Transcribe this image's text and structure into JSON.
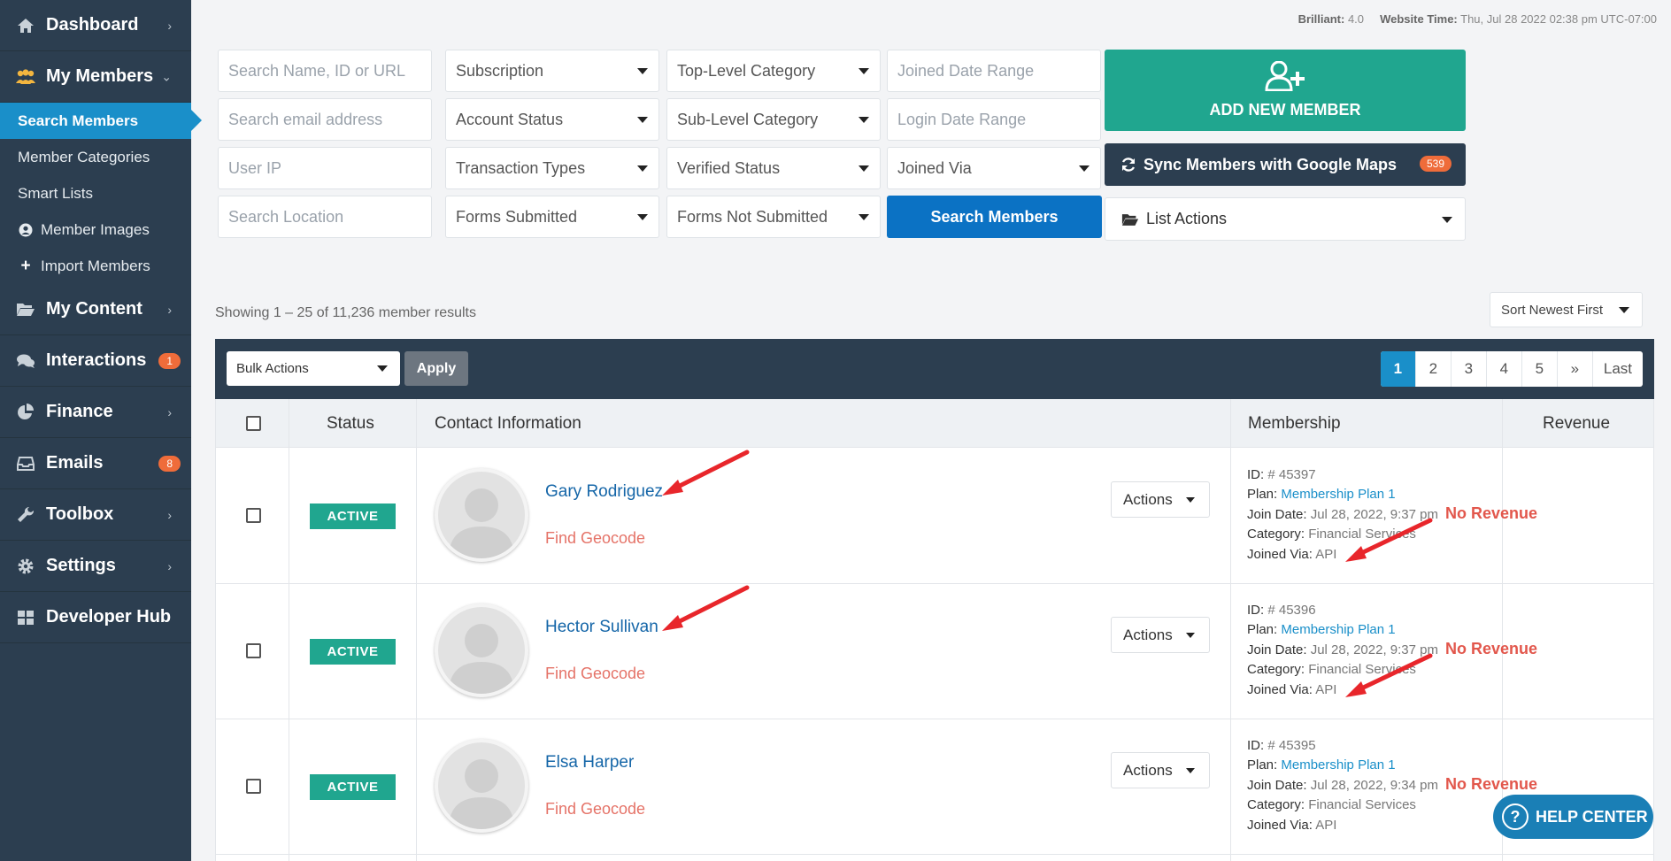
{
  "sidebar": {
    "items": [
      {
        "label": "Dashboard",
        "icon": "home-icon"
      },
      {
        "label": "My Members",
        "icon": "users-icon"
      },
      {
        "label": "My Content",
        "icon": "folder-icon"
      },
      {
        "label": "Interactions",
        "icon": "comments-icon",
        "badge": "1"
      },
      {
        "label": "Finance",
        "icon": "pie-chart-icon"
      },
      {
        "label": "Emails",
        "icon": "inbox-icon",
        "badge": "8"
      },
      {
        "label": "Toolbox",
        "icon": "wrench-icon"
      },
      {
        "label": "Settings",
        "icon": "gear-icon"
      },
      {
        "label": "Developer Hub",
        "icon": "grid-icon"
      }
    ],
    "submenu": [
      {
        "label": "Search Members"
      },
      {
        "label": "Member Categories"
      },
      {
        "label": "Smart Lists"
      },
      {
        "label": "Member Images",
        "icon": "user-circle-icon"
      },
      {
        "label": "Import Members",
        "icon": "plus-icon"
      }
    ]
  },
  "header": {
    "version_label": "Brilliant:",
    "version_value": "4.0",
    "time_label": "Website Time:",
    "time_value": "Thu, Jul 28 2022 02:38 pm UTC-07:00"
  },
  "filters": {
    "search_name": "Search Name, ID or URL",
    "subscription": "Subscription",
    "top_category": "Top-Level Category",
    "joined_range": "Joined Date Range",
    "search_email": "Search email address",
    "account_status": "Account Status",
    "sub_category": "Sub-Level Category",
    "login_range": "Login Date Range",
    "user_ip": "User IP",
    "transaction_types": "Transaction Types",
    "verified_status": "Verified Status",
    "joined_via": "Joined Via",
    "search_location": "Search Location",
    "forms_submitted": "Forms Submitted",
    "forms_not_submitted": "Forms Not Submitted",
    "search_button": "Search Members"
  },
  "actions": {
    "add_member": "ADD NEW MEMBER",
    "sync_maps": "Sync Members with Google Maps",
    "sync_count": "539",
    "list_actions": "List Actions"
  },
  "results": {
    "showing": "Showing 1 – 25 of 11,236 member results",
    "sort": "Sort Newest First",
    "bulk_actions": "Bulk Actions",
    "apply": "Apply",
    "pages": [
      "1",
      "2",
      "3",
      "4",
      "5",
      "»",
      "Last"
    ]
  },
  "table": {
    "headers": {
      "status": "Status",
      "contact": "Contact Information",
      "membership": "Membership",
      "revenue": "Revenue"
    },
    "rows": [
      {
        "status": "ACTIVE",
        "name": "Gary Rodriguez",
        "geocode": "Find Geocode",
        "actions": "Actions",
        "id_label": "ID:",
        "id": "# 45397",
        "plan_label": "Plan:",
        "plan": "Membership Plan 1",
        "join_label": "Join Date:",
        "join": "Jul 28, 2022, 9:37 pm",
        "category_label": "Category:",
        "category": "Financial Services",
        "via_label": "Joined Via:",
        "via": "API",
        "revenue": "No Revenue"
      },
      {
        "status": "ACTIVE",
        "name": "Hector Sullivan",
        "geocode": "Find Geocode",
        "actions": "Actions",
        "id_label": "ID:",
        "id": "# 45396",
        "plan_label": "Plan:",
        "plan": "Membership Plan 1",
        "join_label": "Join Date:",
        "join": "Jul 28, 2022, 9:37 pm",
        "category_label": "Category:",
        "category": "Financial Services",
        "via_label": "Joined Via:",
        "via": "API",
        "revenue": "No Revenue"
      },
      {
        "status": "ACTIVE",
        "name": "Elsa Harper",
        "geocode": "Find Geocode",
        "actions": "Actions",
        "id_label": "ID:",
        "id": "# 45395",
        "plan_label": "Plan:",
        "plan": "Membership Plan 1",
        "join_label": "Join Date:",
        "join": "Jul 28, 2022, 9:34 pm",
        "category_label": "Category:",
        "category": "Financial Services",
        "via_label": "Joined Via:",
        "via": "API",
        "revenue": "No Revenue"
      }
    ]
  },
  "help": {
    "label": "HELP CENTER"
  },
  "colors": {
    "sidebar": "#2c3e50",
    "accent_blue": "#1a8fc9",
    "teal": "#20a68f",
    "badge": "#ef6c3a",
    "annotation_arrow": "#e8262b"
  }
}
